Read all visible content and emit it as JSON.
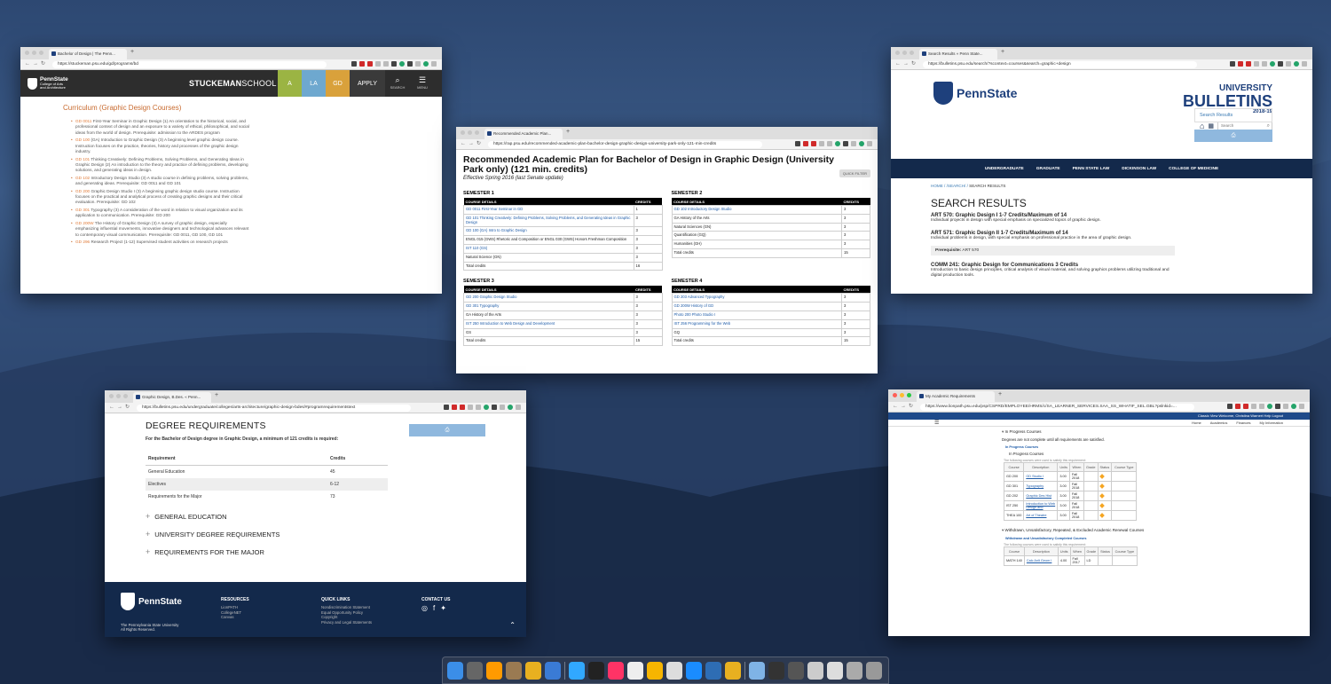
{
  "desktop": {
    "accent": "#1e407c",
    "dock_apps": [
      "finder-icon",
      "dashboard-icon",
      "illustrator-icon",
      "notes-icon",
      "chrome-icon",
      "safari-compass-icon",
      "photoshop-icon",
      "terminal-icon",
      "indesign-icon",
      "sketch-icon",
      "gem-icon",
      "itunes-icon",
      "safari-icon",
      "nav-icon",
      "chrome-icon",
      "folder-icon",
      "screen-icon",
      "folder-icon",
      "doc-icon",
      "doc-icon",
      "photo-icon",
      "trash-icon"
    ]
  },
  "win1": {
    "tab_title": "Bachelor of Design | The Penn...",
    "url": "https://stuckeman.psu.edu/gd/programs/bd",
    "logo_name": "PennState",
    "logo_sub1": "College of Arts",
    "logo_sub2": "and Architecture",
    "site_title_bold": "STUCKEMAN",
    "site_title_rest": "SCHOOL",
    "nav": [
      "A",
      "LA",
      "GD",
      "APPLY"
    ],
    "search_label": "SEARCH",
    "menu_label": "MENU",
    "heading": "Curriculum (Graphic Design Courses)",
    "courses": [
      {
        "code": "GD 0011",
        "text": " First-Year Seminar in Graphic Design (1) An orientation to the historical, social, and professional context of design and an exposure to a variety of ethical, philosophical, and social ideas from the world of design. Prerequisite: admission to the ARDES program"
      },
      {
        "code": "GD 100",
        "text": " (GA) Introduction to Graphic Design (3) A beginning level graphic design course. Instruction focuses on the practice, theories, history and processes of the graphic design industry."
      },
      {
        "code": "GD 101",
        "text": " Thinking Creatively: Defining Problems, Solving Problems, and Generating Ideas in Graphic Design (2) An introduction to the theory and practice of defining problems, developing solutions, and generating ideas in design."
      },
      {
        "code": "GD 102",
        "text": " Introductory Design Studio (3) A studio course in defining problems, solving problems, and generating ideas. Prerequisite: GD 0011 and GD 101"
      },
      {
        "code": "GD 200",
        "text": " Graphic Design Studio I (3) A beginning graphic design studio course. Instruction focuses on the practical and analytical process of creating graphic designs and their critical evaluation. Prerequisite: GD 102"
      },
      {
        "code": "GD 301",
        "text": " Typography (3) A consideration of the word in relation to visual organization and its application to communication. Prerequisite: GD 200"
      },
      {
        "code": "GD 200W",
        "text": " The History of Graphic Design (3) A survey of graphic design, especially emphasizing influential movements, innovative designers and technological advances relevant to contemporary visual communication. Prerequisite: GD 0011, GD 100, GD 101"
      },
      {
        "code": "GD 296",
        "text": " Research Project (1-12) Supervised student activities on research projects"
      }
    ]
  },
  "win2": {
    "tab_title": "Recommended Academic Plan...",
    "url": "https://rap.psu.edu/recommended-academic-plan-bachelor-design-graphic-design-university-park-only-121-min-credits",
    "title": "Recommended Academic Plan for Bachelor of Design in Graphic Design (University Park only) (121 min. credits)",
    "subtitle": "Effective Spring 2016 (last Senate update)",
    "quick_filter": "QUICK FILTER",
    "col_details": "COURSE DETAILS",
    "col_credits": "CREDITS",
    "semesters": [
      {
        "name": "SEMESTER 1",
        "rows": [
          {
            "c": "GD 0011 First-Year Seminar in GD",
            "v": "1",
            "link": true
          },
          {
            "c": "GD 101 Thinking Creatively: Defining Problems, Solving Problems, and Generating Ideas in Graphic Design",
            "v": "3",
            "link": true
          },
          {
            "c": "GD 100 (GA) Intro to Graphic Design",
            "v": "3",
            "link": true
          },
          {
            "c": "ENGL 015 (GWS) Rhetoric and Composition or ENGL 030 (GWS) Honors Freshman Composition",
            "v": "3",
            "link": false
          },
          {
            "c": "IST 110 (GS)",
            "v": "3",
            "link": true
          },
          {
            "c": "Natural Science (GN)",
            "v": "3",
            "link": false
          },
          {
            "c": "Total credits",
            "v": "16",
            "link": false
          }
        ]
      },
      {
        "name": "SEMESTER 2",
        "rows": [
          {
            "c": "GD 102 Introductory Design Studio",
            "v": "3",
            "link": true
          },
          {
            "c": "GA History of the Arts",
            "v": "3",
            "link": false
          },
          {
            "c": "Natural Sciences (GN)",
            "v": "3",
            "link": false
          },
          {
            "c": "Quantification (GQ)",
            "v": "3",
            "link": false
          },
          {
            "c": "Humanities (GH)",
            "v": "3",
            "link": false
          },
          {
            "c": "Total credits",
            "v": "15",
            "link": false
          }
        ]
      },
      {
        "name": "SEMESTER 3",
        "rows": [
          {
            "c": "GD 200 Graphic Design Studio",
            "v": "3",
            "link": true
          },
          {
            "c": "GD 301 Typography",
            "v": "3",
            "link": true
          },
          {
            "c": "GA History of the Arts",
            "v": "3",
            "link": false
          },
          {
            "c": "IST 250 Introduction to Web Design and Development",
            "v": "3",
            "link": true
          },
          {
            "c": "GS",
            "v": "3",
            "link": false
          },
          {
            "c": "Total credits",
            "v": "15",
            "link": false
          }
        ]
      },
      {
        "name": "SEMESTER 4",
        "rows": [
          {
            "c": "GD 203 Advanced Typography",
            "v": "3",
            "link": true
          },
          {
            "c": "GD 200W History of GD",
            "v": "3",
            "link": true
          },
          {
            "c": "Photo 200 Photo Studio I",
            "v": "3",
            "link": true
          },
          {
            "c": "IST 256 Programming for the Web",
            "v": "3",
            "link": true
          },
          {
            "c": "GQ",
            "v": "3",
            "link": false
          },
          {
            "c": "Total credits",
            "v": "15",
            "link": false
          }
        ]
      }
    ]
  },
  "win3": {
    "tab_title": "Search Results « Penn State...",
    "url": "https://bulletins.psu.edu/search/?scontext=courses&search=graphic+design",
    "logo_name": "PennState",
    "title_univ": "UNIVERSITY",
    "title_bulletins": "BULLETINS",
    "title_year": "2018-19",
    "search_placeholder": "Search",
    "nav": [
      "UNDERGRADUATE",
      "GRADUATE",
      "PENN STATE LAW",
      "DICKINSON LAW",
      "COLLEGE OF MEDICINE"
    ],
    "breadcrumb_1": "HOME",
    "breadcrumb_2": "/SEARCH/",
    "breadcrumb_3": "SEARCH RESULTS",
    "heading": "SEARCH RESULTS",
    "results": [
      {
        "t": "ART 570: Graphic Design I 1-7 Credits/Maximum of 14",
        "d": "Individual projects in design with special emphasis on specialized topics of graphic design."
      },
      {
        "t": "ART 571: Graphic Design II 1-7 Credits/Maximum of 14",
        "d": "Individual problems in design, with special emphasis on professional practice in the area of graphic design."
      },
      {
        "t": "COMM 241: Graphic Design for Communications 3 Credits",
        "d": "Introduction to basic design principles, critical analysis of visual material, and solving graphics problems utilizing traditional and digital production tools."
      }
    ],
    "prereq_label": "Prerequisite:",
    "prereq_value": "ART 570",
    "side_link": "Search Results"
  },
  "win4": {
    "tab_title": "Graphic Design, B.Des. « Penn...",
    "url": "https://bulletins.psu.edu/undergraduate/colleges/arts-architecture/graphic-design-bdes/#programrequirementstext",
    "heading": "DEGREE REQUIREMENTS",
    "lead": "For the Bachelor of Design degree in Graphic Design, a minimum of 121 credits is required:",
    "th_req": "Requirement",
    "th_cr": "Credits",
    "rows": [
      {
        "r": "General Education",
        "c": "45"
      },
      {
        "r": "Electives",
        "c": "6-12"
      },
      {
        "r": "Requirements for the Major",
        "c": "73"
      }
    ],
    "sections": [
      "GENERAL EDUCATION",
      "UNIVERSITY DEGREE REQUIREMENTS",
      "REQUIREMENTS FOR THE MAJOR"
    ],
    "footer_logo": "PennState",
    "footer_copy1": "The Pennsylvania State University",
    "footer_copy2": "All Rights Reserved.",
    "resources_title": "RESOURCES",
    "resources": [
      "LionPATH",
      "CollegeNET",
      "Canvas"
    ],
    "quick_title": "QUICK LINKS",
    "quick": [
      "Nondiscrimination Statement",
      "Equal Opportunity Policy",
      "Copyright",
      "Privacy and Legal Statements"
    ],
    "contact_title": "CONTACT US"
  },
  "win5": {
    "tab_title": "My Academic Requirements",
    "url": "https://www.lionpath.psu.edu/psp/CSPRD/EMPLOYEE/HRMS/c/SA_LEARNER_SERVICES.SAA_SS_WHATIF_SEL.GBL?pslnkid=...",
    "top_links": "Classic View     Welcome, Christina Warnert     Help     Logout",
    "menu": [
      "Home",
      "Academics",
      "Finances",
      "My Information"
    ],
    "s1_title": "In Progress Courses",
    "s1_note": "Degrees are not complete until all requirements are satisfied.",
    "s1_sub": "In Progress Courses",
    "s1_sub2": "In Progress Courses",
    "table_caption": "The following courses were used to satisfy this requirement:",
    "headers": [
      "Course",
      "Description",
      "Units",
      "When",
      "Grade",
      "Status",
      "Course Type"
    ],
    "rows": [
      {
        "c": "GD 200",
        "d": "GD Studio I",
        "u": "3.00",
        "w": "Fall 2018"
      },
      {
        "c": "GD 301",
        "d": "Typography",
        "u": "3.00",
        "w": "Fall 2018"
      },
      {
        "c": "GD 202",
        "d": "Graphic Des Hist",
        "u": "3.00",
        "w": "Fall 2018"
      },
      {
        "c": "IST 250",
        "d": "Introduction to Web Design and",
        "u": "3.00",
        "w": "Fall 2018"
      },
      {
        "c": "THEA 100",
        "d": "Art of Theatre",
        "u": "3.00",
        "w": "Fall 2018"
      }
    ],
    "s2_title": "Withdrawn, Unsatisfactory, Repeated, & Excluded Academic Renewal Courses",
    "s2_sub": "Withdrawn and Unsatisfactory Completed Courses",
    "rows2": [
      {
        "c": "MATH 140",
        "d": "Calc Anlt Geom I",
        "u": "4.00",
        "w": "Fall 2017",
        "g": "LD"
      }
    ]
  }
}
